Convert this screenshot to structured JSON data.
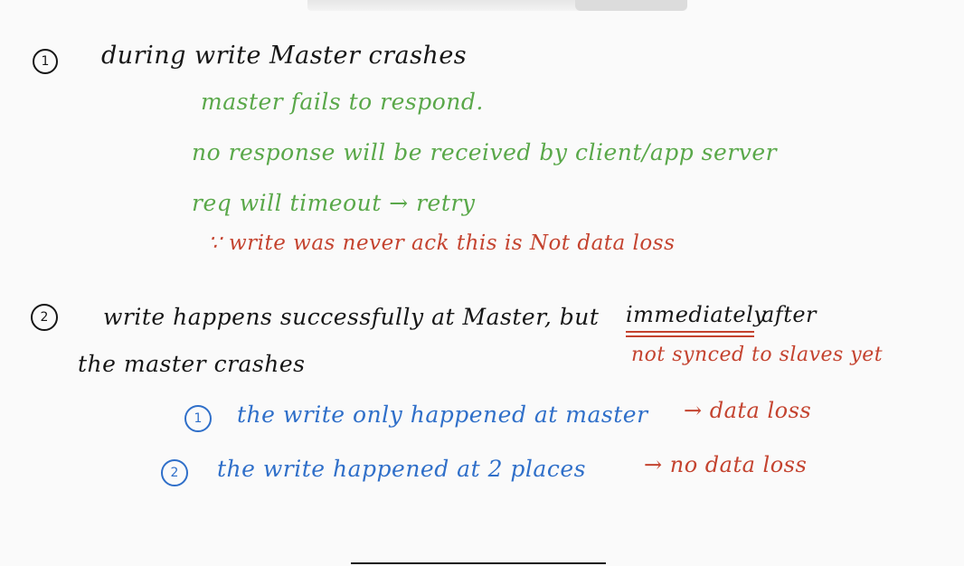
{
  "notes": {
    "item1": {
      "marker": "1",
      "heading": "during write Master crashes",
      "green_lines": [
        "master fails to respond.",
        "no response will be received by client/app server",
        "req will timeout → retry"
      ],
      "red_line": "∵ write was never ack this is Not data loss"
    },
    "item2": {
      "marker": "2",
      "line1_start": "write happens successfully at Master, but",
      "line1_emph": "immediately",
      "line1_end": "after",
      "line2": "the master crashes",
      "red_note": "not synced to slaves yet",
      "sub1": {
        "marker": "1",
        "text": "the write only happened at master",
        "arrow_text": "→ data loss"
      },
      "sub2": {
        "marker": "2",
        "text": "the write happened at 2 places",
        "arrow_text": "→ no data loss"
      }
    }
  },
  "colors": {
    "black_ink": "#161616",
    "green_ink": "#5aa84a",
    "red_ink": "#c4432f",
    "blue_ink": "#2f6fc9"
  }
}
